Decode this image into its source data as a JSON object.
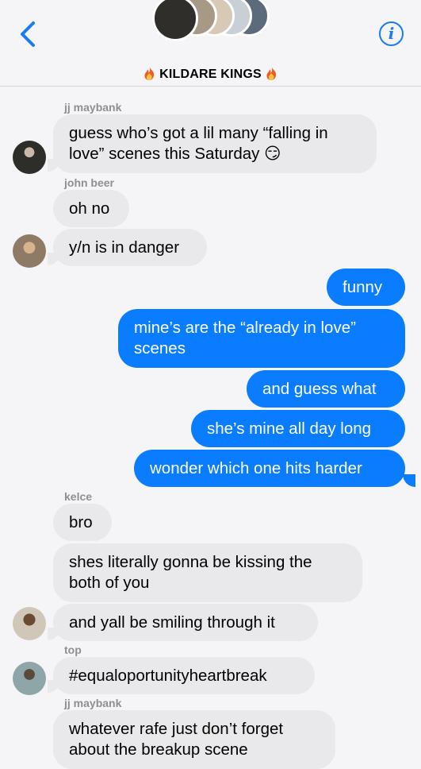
{
  "header": {
    "title": "KILDARE KINGS",
    "back_icon": "chevron-left-icon",
    "info_icon": "info-icon",
    "info_label": "i",
    "accent": "#1a7cf5"
  },
  "messages": [
    {
      "sender": "jj maybank",
      "text": "guess who’s got a lil many “falling in",
      "text2": "love” scenes this Saturday 😏"
    },
    {
      "sender": "john beer",
      "text": "oh no"
    },
    {
      "text": "y/n is in danger"
    },
    {
      "text": "funny"
    },
    {
      "text": "mine’s are the “already in love”",
      "text2": "scenes"
    },
    {
      "text": "and guess what"
    },
    {
      "text": "she’s mine all day long"
    },
    {
      "text": "wonder which one hits harder"
    },
    {
      "sender": "kelce",
      "text": "bro"
    },
    {
      "text": "shes literally gonna be kissing the",
      "text2": "both of you"
    },
    {
      "text": "and yall be smiling through it"
    },
    {
      "sender": "top",
      "text": "#equaloportunityheartbreak"
    },
    {
      "sender": "jj maybank",
      "text": "whatever rafe just don’t forget",
      "text2": "about the breakup scene"
    }
  ],
  "colors": {
    "incoming": "#e9e9eb",
    "outgoing": "#0a7cff",
    "background": "#f5f5f7"
  }
}
